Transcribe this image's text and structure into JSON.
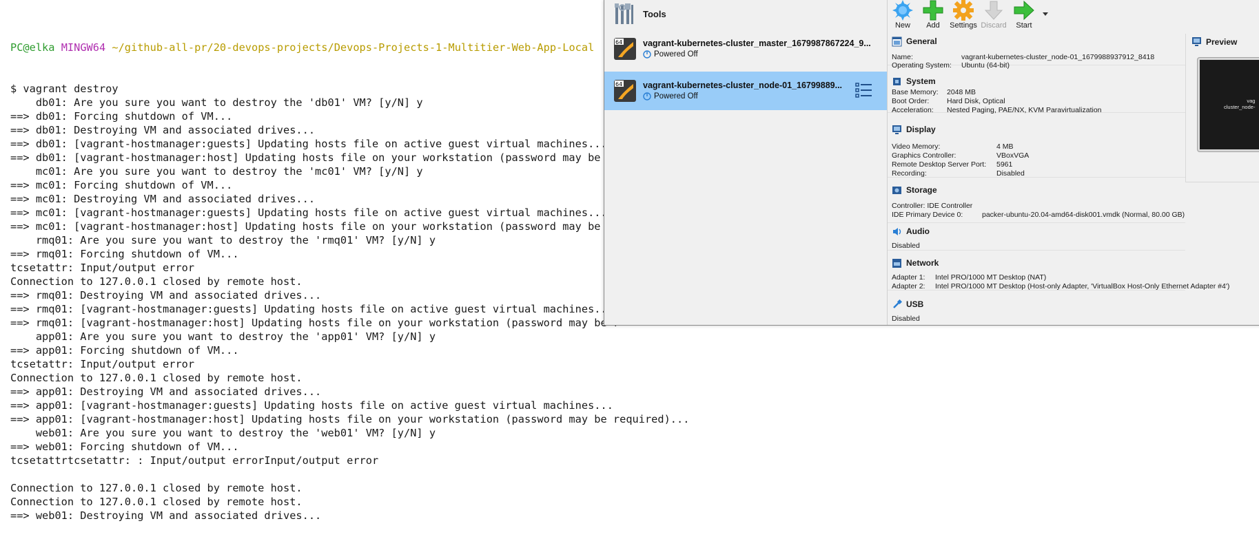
{
  "terminal": {
    "prompt": {
      "user": "PC@elka",
      "system": "MINGW64",
      "path": "~/github-all-pr/20-devops-projects/Devops-Projects-1-Multitier-Web-App-Local"
    },
    "lines": [
      "$ vagrant destroy",
      "    db01: Are you sure you want to destroy the 'db01' VM? [y/N] y",
      "==> db01: Forcing shutdown of VM...",
      "==> db01: Destroying VM and associated drives...",
      "==> db01: [vagrant-hostmanager:guests] Updating hosts file on active guest virtual machines...",
      "==> db01: [vagrant-hostmanager:host] Updating hosts file on your workstation (password may be re",
      "    mc01: Are you sure you want to destroy the 'mc01' VM? [y/N] y",
      "==> mc01: Forcing shutdown of VM...",
      "==> mc01: Destroying VM and associated drives...",
      "==> mc01: [vagrant-hostmanager:guests] Updating hosts file on active guest virtual machines...",
      "==> mc01: [vagrant-hostmanager:host] Updating hosts file on your workstation (password may be re",
      "    rmq01: Are you sure you want to destroy the 'rmq01' VM? [y/N] y",
      "==> rmq01: Forcing shutdown of VM...",
      "tcsetattr: Input/output error",
      "Connection to 127.0.0.1 closed by remote host.",
      "==> rmq01: Destroying VM and associated drives...",
      "==> rmq01: [vagrant-hostmanager:guests] Updating hosts file on active guest virtual machines...",
      "==> rmq01: [vagrant-hostmanager:host] Updating hosts file on your workstation (password may be r",
      "    app01: Are you sure you want to destroy the 'app01' VM? [y/N] y",
      "==> app01: Forcing shutdown of VM...",
      "tcsetattr: Input/output error",
      "Connection to 127.0.0.1 closed by remote host.",
      "==> app01: Destroying VM and associated drives...",
      "==> app01: [vagrant-hostmanager:guests] Updating hosts file on active guest virtual machines...",
      "==> app01: [vagrant-hostmanager:host] Updating hosts file on your workstation (password may be required)...",
      "    web01: Are you sure you want to destroy the 'web01' VM? [y/N] y",
      "==> web01: Forcing shutdown of VM...",
      "tcsetattrtcsetattr: : Input/output errorInput/output error",
      "",
      "Connection to 127.0.0.1 closed by remote host.",
      "Connection to 127.0.0.1 closed by remote host.",
      "==> web01: Destroying VM and associated drives..."
    ]
  },
  "vbox": {
    "tools_label": "Tools",
    "vms": [
      {
        "name": "vagrant-kubernetes-cluster_master_1679987867224_9...",
        "state": "Powered Off"
      },
      {
        "name": "vagrant-kubernetes-cluster_node-01_16799889...",
        "state": "Powered Off"
      }
    ],
    "toolbar": {
      "new": "New",
      "add": "Add",
      "settings": "Settings",
      "discard": "Discard",
      "start": "Start"
    },
    "general": {
      "title": "General",
      "name_k": "Name:",
      "name_v": "vagrant-kubernetes-cluster_node-01_1679988937912_8418",
      "os_k": "Operating System:",
      "os_v": "Ubuntu (64-bit)"
    },
    "system": {
      "title": "System",
      "mem_k": "Base Memory:",
      "mem_v": "2048 MB",
      "boot_k": "Boot Order:",
      "boot_v": "Hard Disk, Optical",
      "accel_k": "Acceleration:",
      "accel_v": "Nested Paging, PAE/NX, KVM Paravirtualization"
    },
    "display": {
      "title": "Display",
      "vmem_k": "Video Memory:",
      "vmem_v": "4 MB",
      "gc_k": "Graphics Controller:",
      "gc_v": "VBoxVGA",
      "rdp_k": "Remote Desktop Server Port:",
      "rdp_v": "5961",
      "rec_k": "Recording:",
      "rec_v": "Disabled"
    },
    "storage": {
      "title": "Storage",
      "ctrl": "Controller: IDE Controller",
      "dev_k": " IDE Primary Device 0:",
      "dev_v": "packer-ubuntu-20.04-amd64-disk001.vmdk (Normal, 80.00 GB)"
    },
    "audio": {
      "title": "Audio",
      "value": "Disabled"
    },
    "network": {
      "title": "Network",
      "a1_k": "Adapter 1:",
      "a1_v": "Intel PRO/1000 MT Desktop (NAT)",
      "a2_k": "Adapter 2:",
      "a2_v": "Intel PRO/1000 MT Desktop (Host-only Adapter, 'VirtualBox Host-Only Ethernet Adapter #4')"
    },
    "usb": {
      "title": "USB",
      "value": "Disabled"
    },
    "preview": {
      "title": "Preview",
      "line1": "vag",
      "line2": "cluster_node-"
    }
  }
}
